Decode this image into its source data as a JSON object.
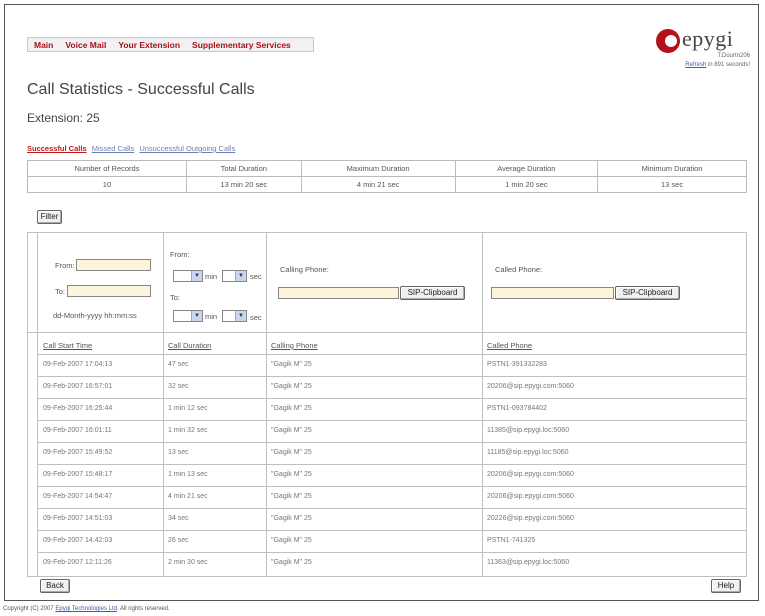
{
  "nav": [
    "Main",
    "Voice Mail",
    "Your Extension",
    "Supplementary Services"
  ],
  "logo": {
    "word": "epygi",
    "user": "T.Dourtn206",
    "refresh_link": "Refresh",
    "refresh_rest": " in 891 seconds!"
  },
  "page_title": "Call Statistics - Successful Calls",
  "extension": "Extension: 25",
  "tabs": [
    {
      "label": "Successful Calls",
      "active": true
    },
    {
      "label": "Missed Calls",
      "active": false
    },
    {
      "label": "Unsuccessful Outgoing Calls",
      "active": false
    }
  ],
  "summary": {
    "headers": [
      "Number of Records",
      "Total Duration",
      "Maximum Duration",
      "Average Duration",
      "Minimum Duration"
    ],
    "values": [
      "10",
      "13 min 20 sec",
      "4 min 21 sec",
      "1 min 20 sec",
      "13 sec"
    ]
  },
  "filter_button": "Filter",
  "filter": {
    "from_label": "From:",
    "to_label": "To:",
    "date_format": "dd-Month-yyyy hh:mm:ss",
    "dur_from_label": "From:",
    "dur_to_label": "To:",
    "min_label": "min",
    "sec_label": "sec",
    "calling_phone_label": "Calling Phone:",
    "called_phone_label": "Called Phone:",
    "clipboard_label": "SIP-Clipboard"
  },
  "columns": [
    "Call Start Time",
    "Call Duration",
    "Calling Phone",
    "Called Phone"
  ],
  "rows": [
    [
      "09-Feb-2007 17:04:13",
      "47 sec",
      "\"Gagik M\" 25",
      "PSTN1-391332283"
    ],
    [
      "09-Feb-2007 16:57:01",
      "32 sec",
      "\"Gagik M\" 25",
      "20206@sip.epygi.com:5060"
    ],
    [
      "09-Feb-2007 16:25:44",
      "1 min 12 sec",
      "\"Gagik M\" 25",
      "PSTN1-093784402"
    ],
    [
      "09-Feb-2007 16:01:11",
      "1 min 32 sec",
      "\"Gagik M\" 25",
      "11385@sip.epygi.loc:5060"
    ],
    [
      "09-Feb-2007 15:49:52",
      "13 sec",
      "\"Gagik M\" 25",
      "11185@sip.epygi.loc:5060"
    ],
    [
      "09-Feb-2007 15:48:17",
      "1 min 13 sec",
      "\"Gagik M\" 25",
      "20206@sip.epygi.com:5060"
    ],
    [
      "09-Feb-2007 14:54:47",
      "4 min 21 sec",
      "\"Gagik M\" 25",
      "20206@sip.epygi.com:5060"
    ],
    [
      "09-Feb-2007 14:51:03",
      "34 sec",
      "\"Gagik M\" 25",
      "20226@sip.epygi.com:5060"
    ],
    [
      "09-Feb-2007 14:42:03",
      "26 sec",
      "\"Gagik M\" 25",
      "PSTN1-741325"
    ],
    [
      "09-Feb-2007 12:11:26",
      "2 min 30 sec",
      "\"Gagik M\" 25",
      "11363@sip.epygi.loc:5060"
    ]
  ],
  "back_button": "Back",
  "help_button": "Help",
  "copyright": {
    "prefix": "Copyright (C) 2007 ",
    "link": "Epygi Technologies Ltd",
    "suffix": ". All rights reserved."
  },
  "colors": {
    "accent": "#a8101a",
    "input_bg": "#fdf4dc",
    "border": "#bfbfbf"
  }
}
